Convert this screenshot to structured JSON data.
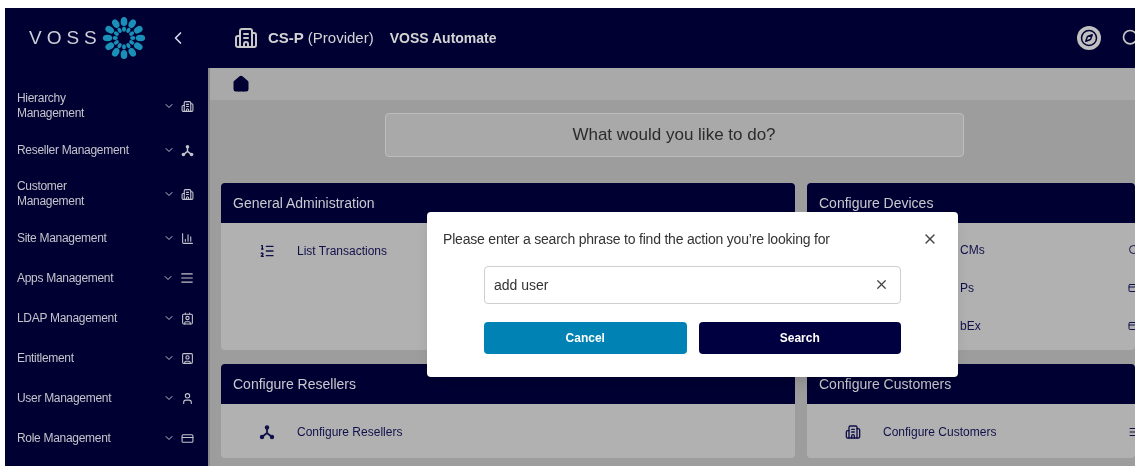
{
  "header": {
    "logo": "VOSS",
    "context": "CS-P",
    "context_type": "(Provider)",
    "app_name": "VOSS Automate"
  },
  "sidebar": {
    "items": [
      {
        "label": "Hierarchy Management",
        "expanded": false
      },
      {
        "label": "Reseller Management",
        "expanded": false
      },
      {
        "label": "Customer Management",
        "expanded": false
      },
      {
        "label": "Site Management",
        "expanded": false
      },
      {
        "label": "Apps Management",
        "expanded": false
      },
      {
        "label": "LDAP Management",
        "expanded": false
      },
      {
        "label": "Entitlement",
        "expanded": false
      },
      {
        "label": "User Management",
        "expanded": false
      },
      {
        "label": "Role Management",
        "expanded": false
      }
    ]
  },
  "search_prompt": "What would you like to do?",
  "cards": [
    {
      "title": "General Administration",
      "kind": "full",
      "items": [
        {
          "label": "List Transactions"
        }
      ]
    },
    {
      "title": "Configure Devices",
      "kind": "partial",
      "items": [
        {
          "label": "CMs"
        },
        {
          "label": "Ps"
        },
        {
          "label": "bEx"
        }
      ]
    },
    {
      "title": "Configure Resellers",
      "kind": "full",
      "items": [
        {
          "label": "Configure Resellers"
        }
      ]
    },
    {
      "title": "Configure Customers",
      "kind": "full",
      "items": [
        {
          "label": "Configure Customers"
        }
      ]
    }
  ],
  "dialog": {
    "prompt": "Please enter a search phrase to find the action you’re looking for",
    "value": "add user",
    "buttons": [
      {
        "label": "Cancel",
        "kind": "secondary"
      },
      {
        "label": "Search",
        "kind": "primary"
      }
    ]
  }
}
